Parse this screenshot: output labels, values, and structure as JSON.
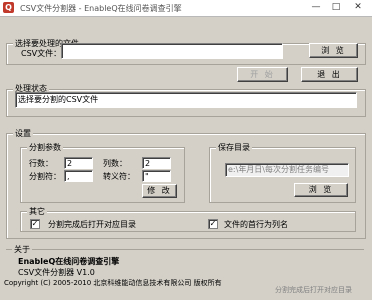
{
  "titlebar": {
    "icon_glyph": "Q",
    "title": "CSV文件分割器 - EnableQ在线问卷调查引擎",
    "minimize": "—",
    "maximize": "□",
    "close": "✕"
  },
  "file_group": {
    "title": "选择要处理的文件",
    "csv_label": "CSV文件：",
    "csv_value": "",
    "browse_label": "浏 览"
  },
  "actions": {
    "start_label": "开 始",
    "exit_label": "退 出"
  },
  "status_group": {
    "title": "处理状态",
    "status_text": "选择要分割的CSV文件"
  },
  "settings_group": {
    "title": "设置",
    "split_params": {
      "title": "分割参数",
      "row_label": "行数：",
      "row_value": "2",
      "col_label": "列数：",
      "col_value": "2",
      "sep_label": "分割符：",
      "sep_value": ",",
      "escape_label": "转义符：",
      "escape_value": "\"",
      "modify_label": "修 改"
    },
    "save_dir": {
      "title": "保存目录",
      "path_value": "e:\\年月日\\每次分割任务编号",
      "browse_label": "浏 览"
    },
    "other": {
      "title": "其它",
      "open_dir_label": "分割完成后打开对应目录",
      "open_dir_checked": true,
      "first_row_label": "文件的首行为列名",
      "first_row_checked": true
    }
  },
  "about_group": {
    "title": "关于",
    "line1": "EnableQ在线问卷调查引擎",
    "line2": "CSV文件分割器 V1.0",
    "line3": "Copyright (C) 2005-2010 北京科维能动信息技术有限公司 版权所有"
  },
  "overlay_text": "分割完成后打开对应目录",
  "check_glyph": "✓",
  "colors": {
    "face": "#d4d0c8",
    "window": "#ffffff",
    "border_dark": "#808080"
  }
}
